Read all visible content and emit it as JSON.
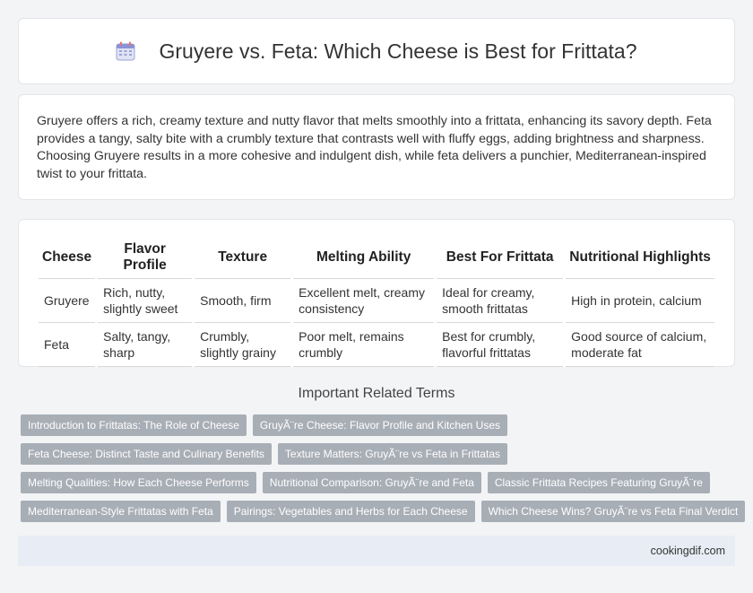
{
  "header": {
    "title": "Gruyere vs. Feta: Which Cheese is Best for Frittata?",
    "icon": "calendar-icon"
  },
  "intro": {
    "text": "Gruyere offers a rich, creamy texture and nutty flavor that melts smoothly into a frittata, enhancing its savory depth. Feta provides a tangy, salty bite with a crumbly texture that contrasts well with fluffy eggs, adding brightness and sharpness. Choosing Gruyere results in a more cohesive and indulgent dish, while feta delivers a punchier, Mediterranean-inspired twist to your frittata."
  },
  "table": {
    "headers": [
      "Cheese",
      "Flavor Profile",
      "Texture",
      "Melting Ability",
      "Best For Frittata",
      "Nutritional Highlights"
    ],
    "rows": [
      [
        "Gruyere",
        "Rich, nutty, slightly sweet",
        "Smooth, firm",
        "Excellent melt, creamy consistency",
        "Ideal for creamy, smooth frittatas",
        "High in protein, calcium"
      ],
      [
        "Feta",
        "Salty, tangy, sharp",
        "Crumbly, slightly grainy",
        "Poor melt, remains crumbly",
        "Best for crumbly, flavorful frittatas",
        "Good source of calcium, moderate fat"
      ]
    ]
  },
  "related": {
    "title": "Important Related Terms",
    "rows": [
      [
        "Introduction to Frittatas: The Role of Cheese",
        "GruyÃ¨re Cheese: Flavor Profile and Kitchen Uses"
      ],
      [
        "Feta Cheese: Distinct Taste and Culinary Benefits",
        "Texture Matters: GruyÃ¨re vs Feta in Frittatas"
      ],
      [
        "Melting Qualities: How Each Cheese Performs",
        "Nutritional Comparison: GruyÃ¨re and Feta",
        "Classic Frittata Recipes Featuring GruyÃ¨re"
      ],
      [
        "Mediterranean-Style Frittatas with Feta",
        "Pairings: Vegetables and Herbs for Each Cheese",
        "Which Cheese Wins? GruyÃ¨re vs Feta Final Verdict"
      ]
    ]
  },
  "footer": {
    "site": "cookingdif.com"
  },
  "colors": {
    "tag_bg": "#a8aeb6",
    "footer_bg": "#e8edf5",
    "page_bg": "#f3f4f6"
  }
}
